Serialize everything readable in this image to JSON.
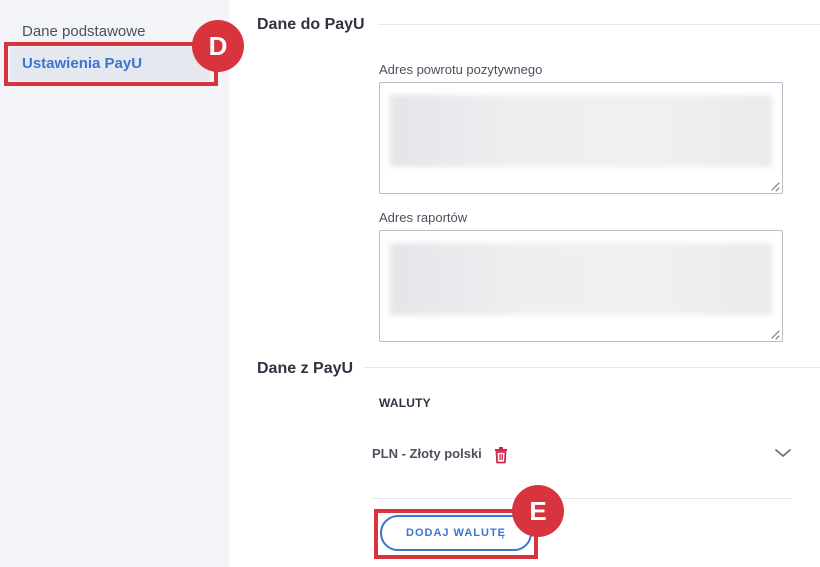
{
  "sidebar": {
    "items": [
      {
        "label": "Dane podstawowe"
      },
      {
        "label": "Ustawienia PayU"
      }
    ]
  },
  "annotations": {
    "badge_d": "D",
    "badge_e": "E",
    "color": "#d8343d"
  },
  "sections": {
    "payu_settings_title": "Dane do PayU",
    "payu_data_title": "Dane z PayU"
  },
  "fields": {
    "return_url_label": "Adres powrotu pozytywnego",
    "reports_url_label": "Adres raportów"
  },
  "currencies": {
    "label": "WALUTY",
    "items": [
      {
        "name": "PLN - Złoty polski"
      }
    ],
    "add_button_label": "DODAJ WALUTĘ"
  },
  "colors": {
    "accent": "#3a76d0",
    "danger": "#d0264f",
    "sidebar_bg": "#f3f4f8"
  },
  "icons": {
    "trash": "trash-icon",
    "chevron": "chevron-down-icon",
    "resize": "resize-handle-icon"
  }
}
